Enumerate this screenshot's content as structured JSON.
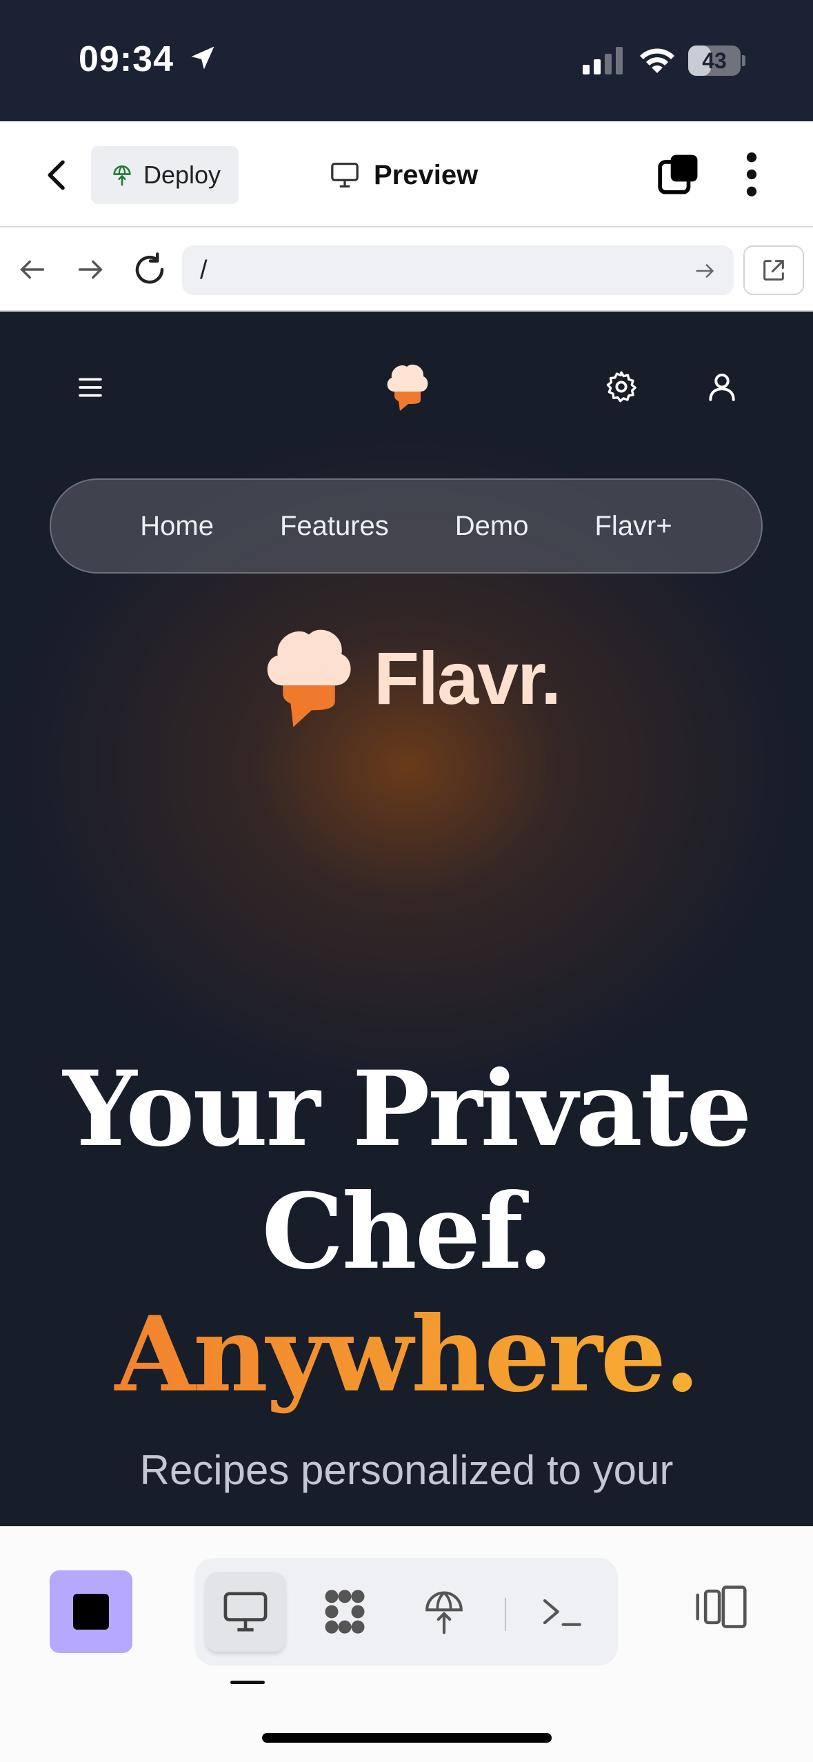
{
  "status_bar": {
    "time": "09:34",
    "battery_level": "43",
    "icons": [
      "location-arrow-icon",
      "cellular-signal-icon",
      "wifi-icon",
      "battery-icon"
    ]
  },
  "app_header": {
    "deploy_label": "Deploy",
    "preview_label": "Preview",
    "icons": [
      "chevron-left-icon",
      "globe-deploy-icon",
      "monitor-icon",
      "stacked-squares-icon",
      "kebab-icon"
    ]
  },
  "browser": {
    "url": "/",
    "icons": [
      "arrow-left-icon",
      "arrow-right-icon",
      "reload-icon",
      "go-arrow-icon",
      "external-link-icon"
    ]
  },
  "site": {
    "nav_links": [
      "Home",
      "Features",
      "Demo",
      "Flavr+"
    ],
    "brand_name": "Flavr.",
    "hero_line_1": "Your Private",
    "hero_line_2": "Chef.",
    "hero_accent": "Anywhere.",
    "hero_subtitle": "Recipes personalized to your",
    "colors": {
      "accent_start": "#f07a2c",
      "accent_end": "#f8b533",
      "brand": "#fde0cf",
      "background": "#181d2a"
    }
  },
  "toolbar": {
    "icons": [
      "stop-icon",
      "monitor-icon",
      "apps-grid-icon",
      "globe-deploy-icon",
      "terminal-icon",
      "panel-toggle-icon"
    ],
    "accent_color": "#b7a8ff"
  }
}
